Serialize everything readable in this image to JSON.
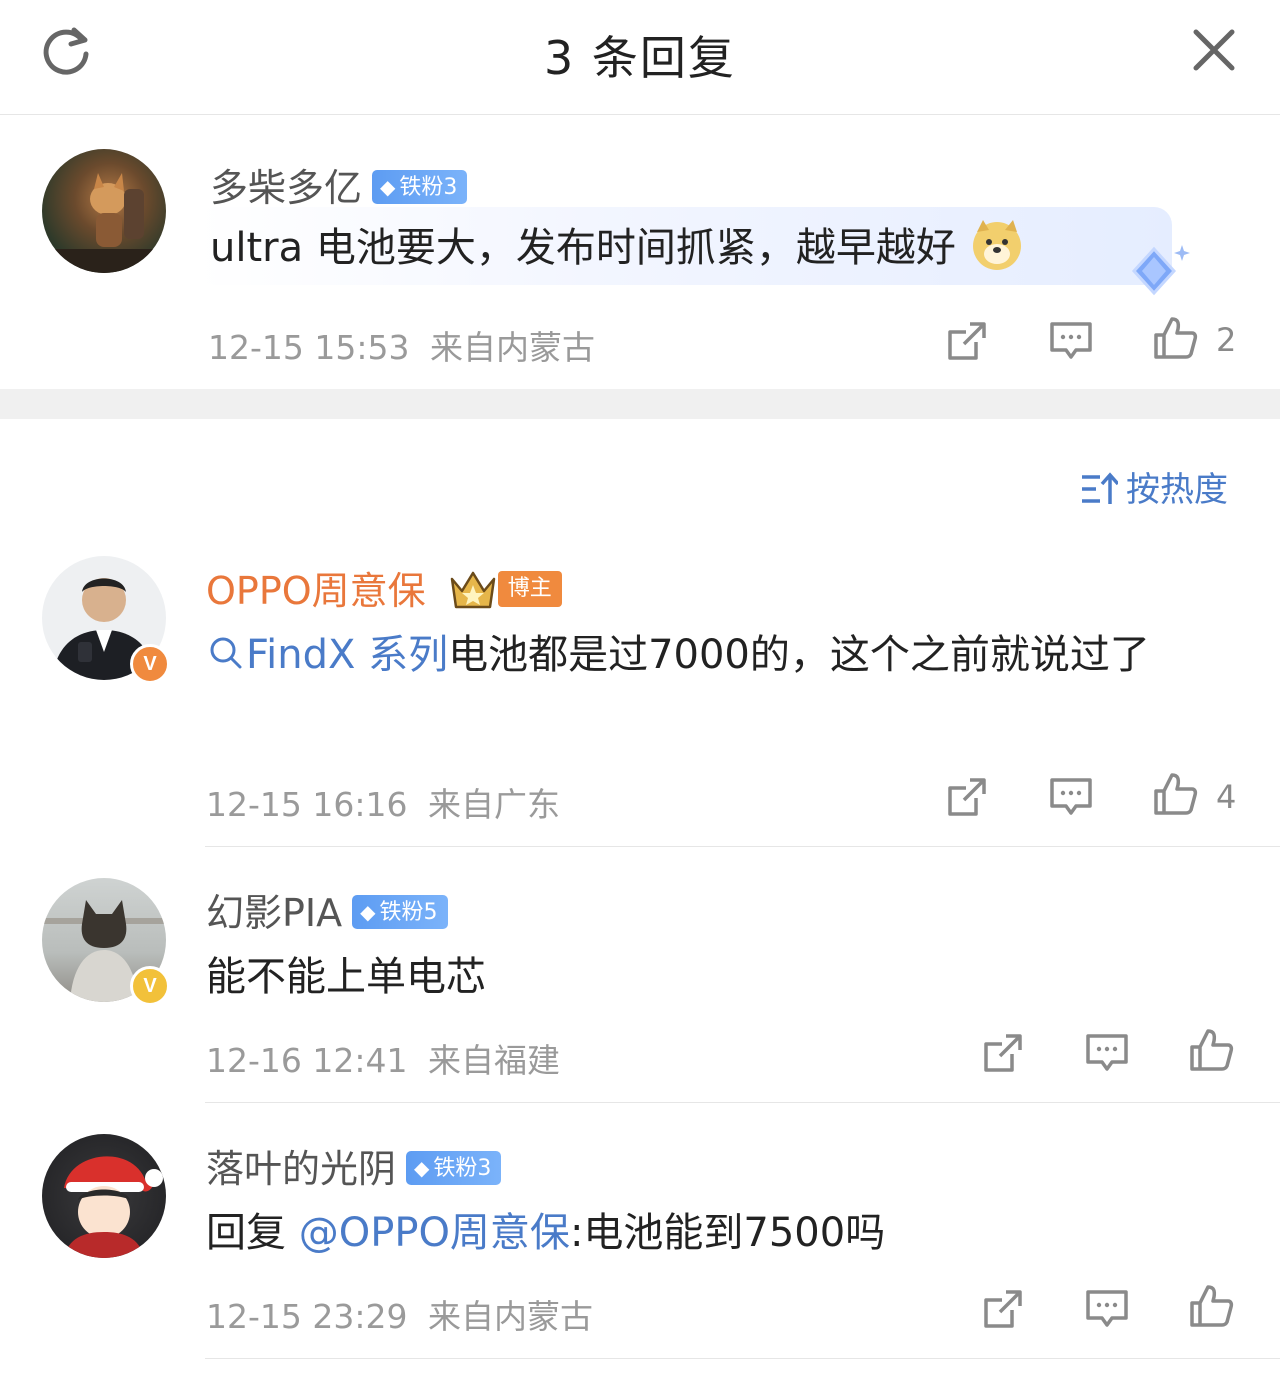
{
  "header": {
    "title": "3 条回复",
    "refresh_icon": "refresh-icon",
    "close_icon": "close-icon"
  },
  "root_comment": {
    "user": "多柴多亿",
    "fan_badge": "铁粉3",
    "text": "ultra 电池要大，发布时间抓紧，越早越好",
    "emoji": "doge-emoji",
    "time": "12-15 15:53",
    "location": "来自内蒙古",
    "likes": "2"
  },
  "sort_label": "按热度",
  "replies": [
    {
      "user": "OPPO周意保",
      "role_badge": "博主",
      "verified": "V",
      "topic_link": "FindX 系列",
      "text": "电池都是过7000的，这个之前就说过了",
      "time": "12-15 16:16",
      "location": "来自广东",
      "likes": "4"
    },
    {
      "user": "幻影PIA",
      "fan_badge": "铁粉5",
      "verified": "V",
      "text": "能不能上单电芯",
      "time": "12-16 12:41",
      "location": "来自福建"
    },
    {
      "user": "落叶的光阴",
      "fan_badge": "铁粉3",
      "reply_prefix": "回复",
      "mention": "@OPPO周意保",
      "text": ":电池能到7500吗",
      "time": "12-15 23:29",
      "location": "来自内蒙古"
    }
  ],
  "colors": {
    "link_blue": "#4a7bc8",
    "blogger_orange": "#e9773b",
    "fan_badge_blue": "#5d9cf2",
    "separator_gray": "#f0f0f0"
  }
}
